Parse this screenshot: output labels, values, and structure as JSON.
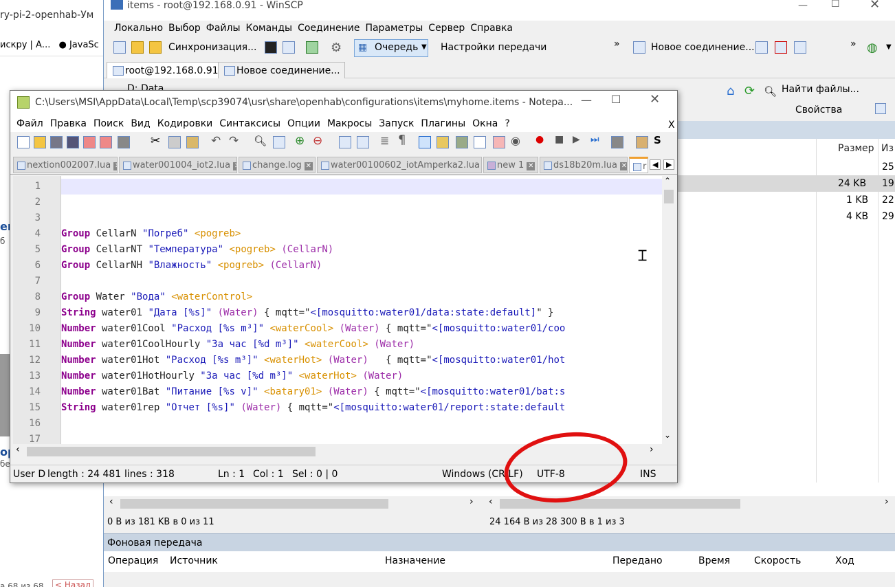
{
  "browser": {
    "tab_title": "ry-pi-2-openhab-Ум",
    "bookmarks": [
      "искру | А...",
      "JavaSc"
    ],
    "partial_text": [
      "ен",
      "б",
      "ор",
      "бед"
    ],
    "pager": "а 68 из 68",
    "back_button": "< Назад"
  },
  "winscp": {
    "title": "items - root@192.168.0.91 - WinSCP",
    "menu": [
      "Локально",
      "Выбор",
      "Файлы",
      "Команды",
      "Соединение",
      "Параметры",
      "Сервер",
      "Справка"
    ],
    "toolbar": {
      "sync": "Синхронизация...",
      "queue": "Очередь",
      "transfer_settings": "Настройки передачи",
      "new_connection": "Новое соединение..."
    },
    "sessions": [
      {
        "label": "root@192.168.0.91"
      },
      {
        "label": "Новое соединение..."
      }
    ],
    "local_path": "D: Data",
    "remote_toolbar": {
      "find": "Найти файлы...",
      "properties": "Свойства"
    },
    "remote_columns": {
      "size": "Размер",
      "changed": "Из"
    },
    "remote_rows": [
      {
        "size": "",
        "date": "25."
      },
      {
        "size": "24 KB",
        "date": "19."
      },
      {
        "size": "1 KB",
        "date": "22."
      },
      {
        "size": "4 KB",
        "date": "29."
      }
    ],
    "status_left": "0 B из 181 KB в 0 из 11",
    "status_right": "24 164 B из 28 300 B в 1 из 3",
    "background_transfer": "Фоновая передача",
    "bg_columns": [
      "Операция",
      "Источник",
      "Назначение",
      "Передано",
      "Время",
      "Скорость",
      "Ход"
    ]
  },
  "npp": {
    "title": "C:\\Users\\MSI\\AppData\\Local\\Temp\\scp39074\\usr\\share\\openhab\\configurations\\items\\myhome.items - Notepa...",
    "menu": [
      "Файл",
      "Правка",
      "Поиск",
      "Вид",
      "Кодировки",
      "Синтаксисы",
      "Опции",
      "Макросы",
      "Запуск",
      "Плагины",
      "Окна",
      "?"
    ],
    "close_x": "X",
    "tabs": [
      "nextion002007.lua",
      "water001004_iot2.lua",
      "change.log",
      "water00100602_iotAmperka2.lua",
      "new 1",
      "ds18b20m.lua",
      "r"
    ],
    "lines": [
      {
        "n": "1",
        "tokens": []
      },
      {
        "n": "2",
        "tokens": []
      },
      {
        "n": "3",
        "tokens": []
      },
      {
        "n": "4",
        "tokens": [
          [
            "kw",
            "Group"
          ],
          [
            "id",
            " CellarN "
          ],
          [
            "str",
            "\"Погреб\""
          ],
          [
            "id",
            " "
          ],
          [
            "tag",
            "<pogreb>"
          ]
        ]
      },
      {
        "n": "5",
        "tokens": [
          [
            "kw",
            "Group"
          ],
          [
            "id",
            " CellarNT "
          ],
          [
            "str",
            "\"Температура\""
          ],
          [
            "id",
            " "
          ],
          [
            "tag",
            "<pogreb>"
          ],
          [
            "id",
            " "
          ],
          [
            "grp",
            "(CellarN)"
          ]
        ]
      },
      {
        "n": "6",
        "tokens": [
          [
            "kw",
            "Group"
          ],
          [
            "id",
            " CellarNH "
          ],
          [
            "str",
            "\"Влажность\""
          ],
          [
            "id",
            " "
          ],
          [
            "tag",
            "<pogreb>"
          ],
          [
            "id",
            " "
          ],
          [
            "grp",
            "(CellarN)"
          ]
        ]
      },
      {
        "n": "7",
        "tokens": []
      },
      {
        "n": "8",
        "tokens": [
          [
            "kw",
            "Group"
          ],
          [
            "id",
            " Water "
          ],
          [
            "str",
            "\"Вода\""
          ],
          [
            "id",
            " "
          ],
          [
            "tag",
            "<waterControl>"
          ]
        ]
      },
      {
        "n": "9",
        "tokens": [
          [
            "kw",
            "String"
          ],
          [
            "id",
            " water01 "
          ],
          [
            "str",
            "\"Дата [%s]\""
          ],
          [
            "id",
            " "
          ],
          [
            "grp",
            "(Water)"
          ],
          [
            "id",
            " { mqtt=\""
          ],
          [
            "str",
            "<[mosquitto:water01/data:state:default]"
          ],
          [
            "id",
            "\" }"
          ]
        ]
      },
      {
        "n": "10",
        "tokens": [
          [
            "kw",
            "Number"
          ],
          [
            "id",
            " water01Cool "
          ],
          [
            "str",
            "\"Расход [%s m³]\""
          ],
          [
            "id",
            " "
          ],
          [
            "tag",
            "<waterCool>"
          ],
          [
            "id",
            " "
          ],
          [
            "grp",
            "(Water)"
          ],
          [
            "id",
            " { mqtt=\""
          ],
          [
            "str",
            "<[mosquitto:water01/coo"
          ]
        ]
      },
      {
        "n": "11",
        "tokens": [
          [
            "kw",
            "Number"
          ],
          [
            "id",
            " water01CoolHourly "
          ],
          [
            "str",
            "\"За час [%d m³]\""
          ],
          [
            "id",
            " "
          ],
          [
            "tag",
            "<waterCool>"
          ],
          [
            "id",
            " "
          ],
          [
            "grp",
            "(Water)"
          ]
        ]
      },
      {
        "n": "12",
        "tokens": [
          [
            "kw",
            "Number"
          ],
          [
            "id",
            " water01Hot "
          ],
          [
            "str",
            "\"Расход [%s m³]\""
          ],
          [
            "id",
            " "
          ],
          [
            "tag",
            "<waterHot>"
          ],
          [
            "id",
            " "
          ],
          [
            "grp",
            "(Water)"
          ],
          [
            "id",
            "   { mqtt=\""
          ],
          [
            "str",
            "<[mosquitto:water01/hot"
          ]
        ]
      },
      {
        "n": "13",
        "tokens": [
          [
            "kw",
            "Number"
          ],
          [
            "id",
            " water01HotHourly "
          ],
          [
            "str",
            "\"За час [%d m³]\""
          ],
          [
            "id",
            " "
          ],
          [
            "tag",
            "<waterHot>"
          ],
          [
            "id",
            " "
          ],
          [
            "grp",
            "(Water)"
          ]
        ]
      },
      {
        "n": "14",
        "tokens": [
          [
            "kw",
            "Number"
          ],
          [
            "id",
            " water01Bat "
          ],
          [
            "str",
            "\"Питание [%s v]\""
          ],
          [
            "id",
            " "
          ],
          [
            "tag",
            "<batary01>"
          ],
          [
            "id",
            " "
          ],
          [
            "grp",
            "(Water)"
          ],
          [
            "id",
            " { mqtt=\""
          ],
          [
            "str",
            "<[mosquitto:water01/bat:s"
          ]
        ]
      },
      {
        "n": "15",
        "tokens": [
          [
            "kw",
            "String"
          ],
          [
            "id",
            " water01rep "
          ],
          [
            "str",
            "\"Отчет [%s]\""
          ],
          [
            "id",
            " "
          ],
          [
            "grp",
            "(Water)"
          ],
          [
            "id",
            " { mqtt=\""
          ],
          [
            "str",
            "<[mosquitto:water01/report:state:default"
          ]
        ]
      },
      {
        "n": "16",
        "tokens": []
      },
      {
        "n": "17",
        "tokens": []
      }
    ],
    "status": {
      "type": "User D",
      "length": "length : 24 481",
      "lines": "lines : 318",
      "ln": "Ln : 1",
      "col": "Col : 1",
      "sel": "Sel : 0 | 0",
      "eol": "Windows (CR LF)",
      "encoding": "UTF-8",
      "mode": "INS"
    }
  },
  "colors": {
    "annotation": "#e01010",
    "keyword": "#8c008c",
    "string": "#1a1ab8",
    "tag": "#d89000"
  }
}
